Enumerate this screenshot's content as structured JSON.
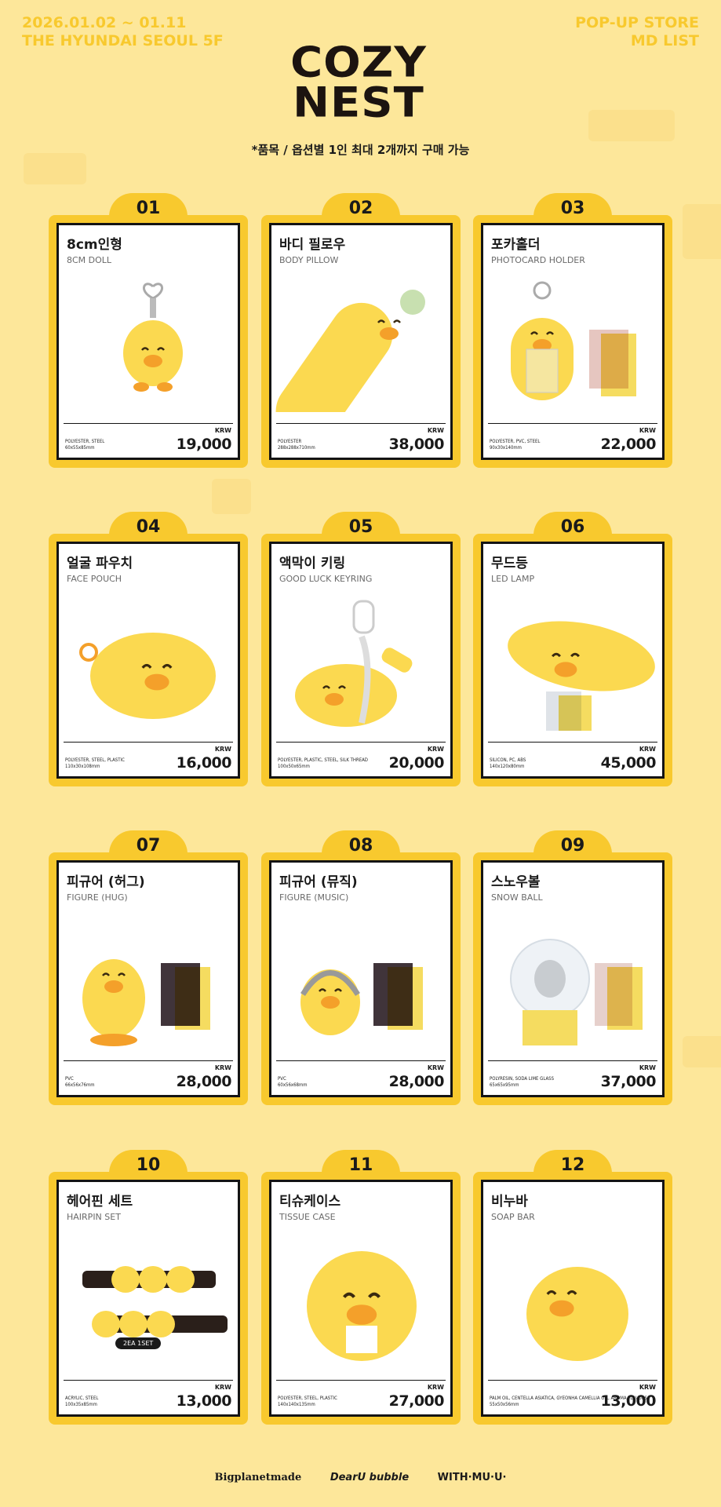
{
  "header": {
    "date": "2026.01.02 ~ 01.11",
    "venue": "THE HYUNDAI SEOUL 5F",
    "store": "POP-UP STORE",
    "list": "MD LIST",
    "logo_top": "COZY",
    "logo_bottom": "NEST",
    "notice": "*품목 / 옵션별 1인 최대 2개까지 구매 가능"
  },
  "currency": "KRW",
  "products": [
    {
      "no": "01",
      "kor": "8cm인형",
      "eng": "8CM DOLL",
      "mat": "POLYESTER, STEEL",
      "size": "60x55x85mm",
      "price": "19,000"
    },
    {
      "no": "02",
      "kor": "바디 필로우",
      "eng": "BODY PILLOW",
      "mat": "POLYESTER",
      "size": "288x288x710mm",
      "price": "38,000"
    },
    {
      "no": "03",
      "kor": "포카홀더",
      "eng": "PHOTOCARD HOLDER",
      "mat": "POLYESTER, PVC, STEEL",
      "size": "90x30x140mm",
      "price": "22,000"
    },
    {
      "no": "04",
      "kor": "얼굴 파우치",
      "eng": "FACE POUCH",
      "mat": "POLYESTER, STEEL, PLASTIC",
      "size": "110x30x108mm",
      "price": "16,000"
    },
    {
      "no": "05",
      "kor": "액막이 키링",
      "eng": "GOOD LUCK KEYRING",
      "mat": "POLYESTER, PLASTIC, STEEL, SILK THREAD",
      "size": "100x50x65mm",
      "price": "20,000"
    },
    {
      "no": "06",
      "kor": "무드등",
      "eng": "LED LAMP",
      "mat": "SILICON, PC, ABS",
      "size": "140x120x80mm",
      "price": "45,000"
    },
    {
      "no": "07",
      "kor": "피규어 (허그)",
      "eng": "FIGURE (HUG)",
      "mat": "PVC",
      "size": "66x56x76mm",
      "price": "28,000"
    },
    {
      "no": "08",
      "kor": "피규어 (뮤직)",
      "eng": "FIGURE (MUSIC)",
      "mat": "PVC",
      "size": "60x56x68mm",
      "price": "28,000"
    },
    {
      "no": "09",
      "kor": "스노우볼",
      "eng": "SNOW BALL",
      "mat": "POLYRESIN, SODA LIME GLASS",
      "size": "65x65x95mm",
      "price": "37,000"
    },
    {
      "no": "10",
      "kor": "헤어핀 세트",
      "eng": "HAIRPIN SET",
      "mat": "ACRYLIC, STEEL",
      "size": "100x35x85mm",
      "price": "13,000",
      "badge": "2EA 1SET"
    },
    {
      "no": "11",
      "kor": "티슈케이스",
      "eng": "TISSUE CASE",
      "mat": "POLYESTER, STEEL, PLASTIC",
      "size": "140x140x135mm",
      "price": "27,000"
    },
    {
      "no": "12",
      "kor": "비누바",
      "eng": "SOAP BAR",
      "mat": "PALM OIL, CENTELLA ASIATICA, GYEONHA CAMELLIA OIL, AROMA FLAVORS",
      "size": "55x50x56mm",
      "price": "13,000"
    }
  ],
  "footer": {
    "brand1": "Bigplanetmade",
    "brand2": "DearU bubble",
    "brand3": "WITH·MU·U·"
  },
  "colors": {
    "bg": "#fde79a",
    "accent": "#f8c92e",
    "duck": "#fbd950",
    "beak": "#f4a02a"
  }
}
